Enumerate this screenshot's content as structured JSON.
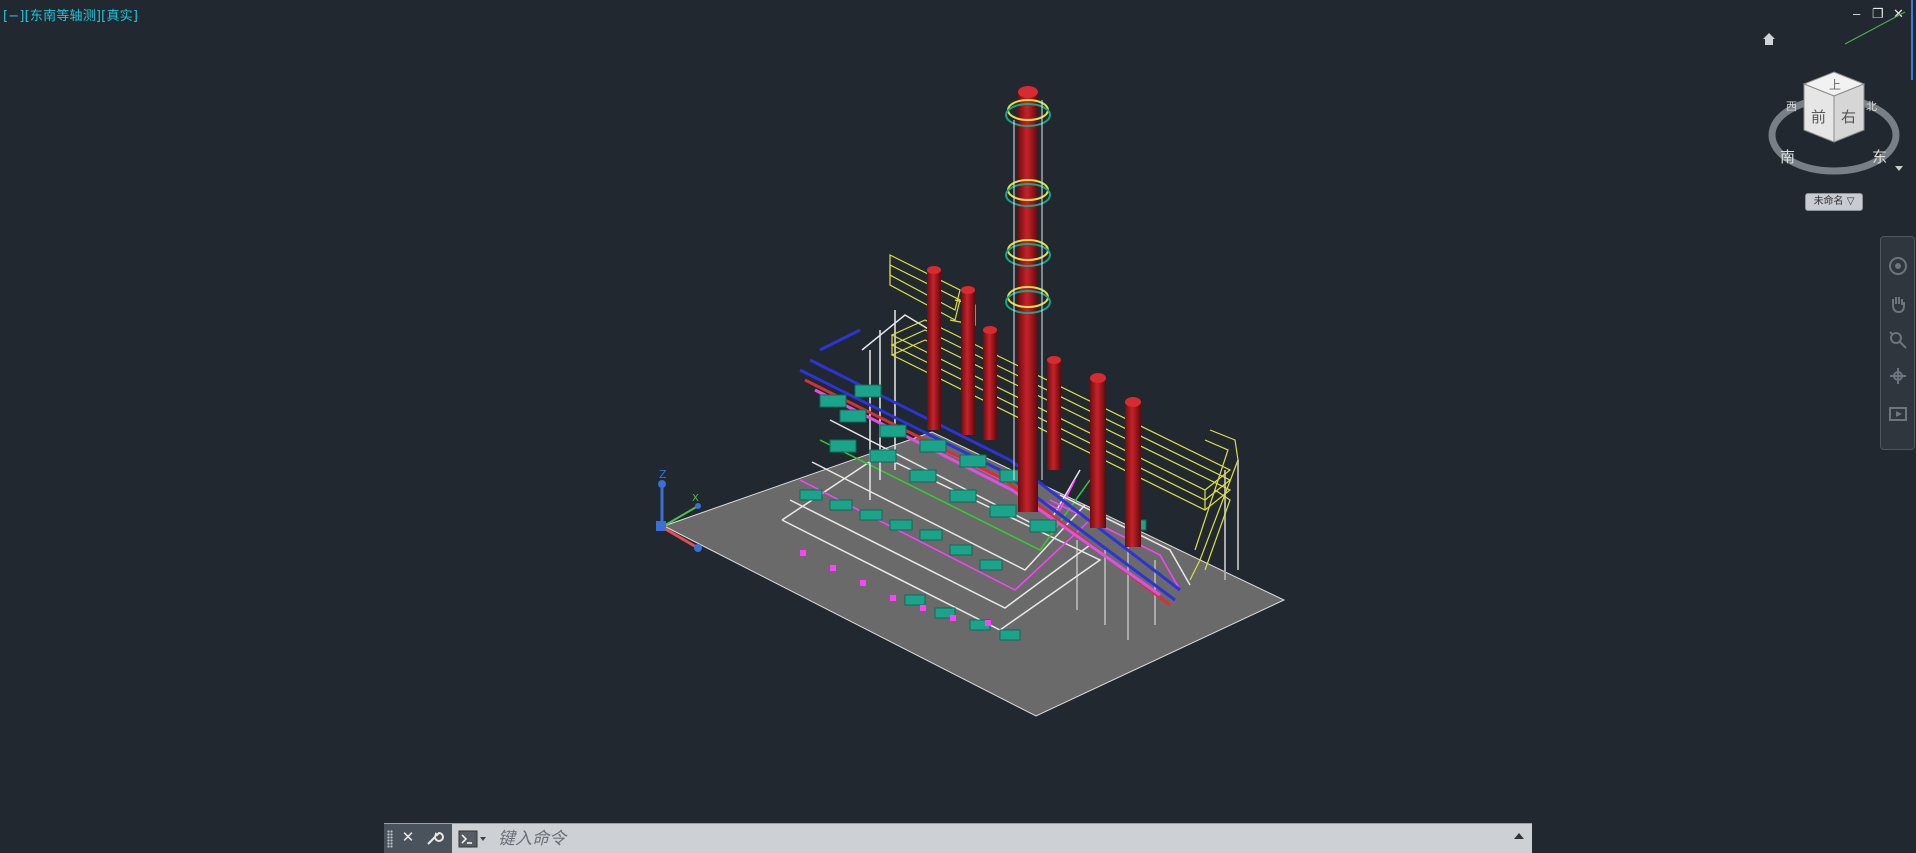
{
  "viewport": {
    "label": "[−][东南等轴测][真实]"
  },
  "window_controls": {
    "minimize": "–",
    "restore": "❐",
    "close": "✕"
  },
  "viewcube": {
    "top_face": "上",
    "front_face": "前",
    "right_face": "右",
    "compass_west": "西",
    "compass_south": "南",
    "compass_east": "东",
    "compass_north": "北",
    "view_name": "未命名 ▽"
  },
  "ucs": {
    "x_label": "X",
    "z_label": "Z"
  },
  "command_line": {
    "placeholder": "键入命令",
    "close_label": "✕",
    "customize_label": "🔧"
  },
  "colors": {
    "background": "#212830",
    "accent_label": "#21c4d8",
    "ground": "#6b6b6b",
    "column": "#b3151c",
    "platform": "#e0e040",
    "equipment": "#1aa58a"
  },
  "icons": {
    "home": "home-icon",
    "steering_wheel": "steering-wheel-icon",
    "pan": "pan-hand-icon",
    "zoom": "zoom-icon",
    "orbit": "orbit-icon",
    "showmotion": "showmotion-icon",
    "prompt": "command-prompt-icon",
    "wrench": "wrench-icon",
    "history": "history-arrow-icon"
  }
}
